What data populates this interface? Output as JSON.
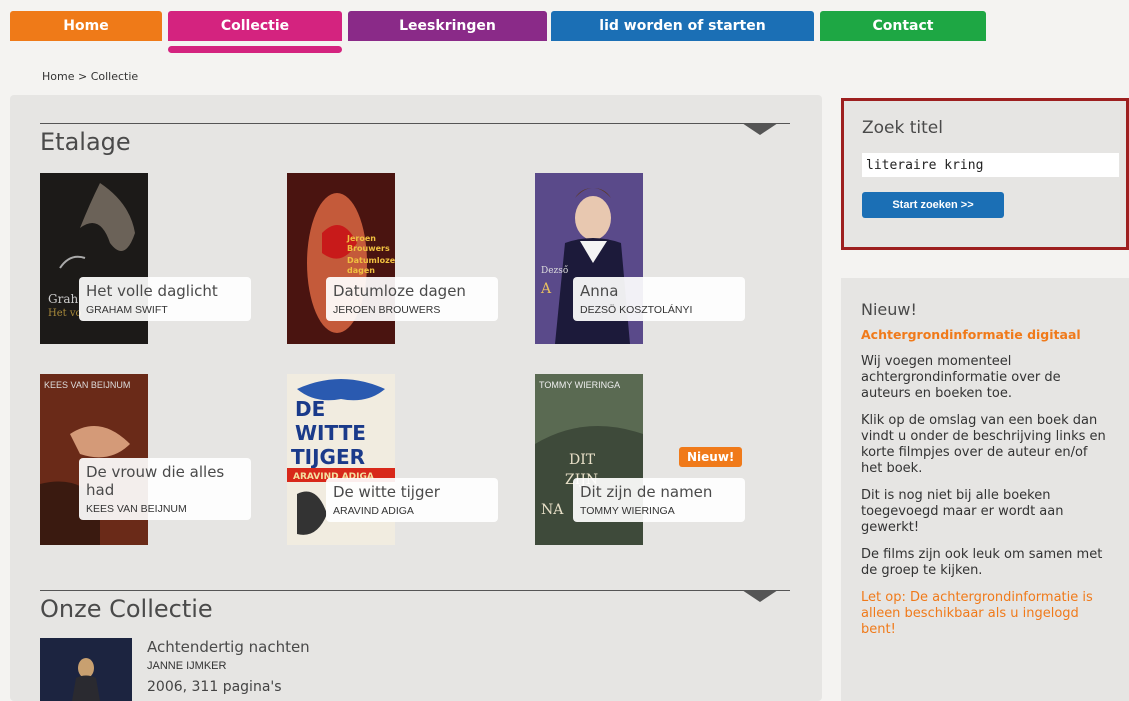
{
  "nav": {
    "tabs": [
      {
        "label": "Home",
        "color": "#ef7a18"
      },
      {
        "label": "Collectie",
        "color": "#d4237f"
      },
      {
        "label": "Leeskringen",
        "color": "#8a2a88"
      },
      {
        "label": "lid worden of starten",
        "color": "#1b6fb5"
      },
      {
        "label": "Contact",
        "color": "#1ea744"
      }
    ]
  },
  "breadcrumb": "Home > Collectie",
  "etalage": {
    "title": "Etalage",
    "books": [
      {
        "title": "Het volle daglicht",
        "author": "GRAHAM SWIFT",
        "cover_text": "Graham Swift\nHet volle",
        "cover_color": "#1c1a18"
      },
      {
        "title": "Datumloze dagen",
        "author": "JEROEN BROUWERS",
        "cover_text": "Jeroen Brouwers Datumloze dagen",
        "cover_color": "#4a1410"
      },
      {
        "title": "Anna",
        "author": "DEZSÖ KOSZTOLÁNYI",
        "cover_text": "Dezső Kosztolányi Anna",
        "cover_color": "#3a2a6a"
      },
      {
        "title": "De vrouw die alles had",
        "author": "KEES VAN BEIJNUM",
        "cover_text": "KEES VAN BEIJNUM",
        "cover_color": "#7a3a1e"
      },
      {
        "title": "De witte tijger",
        "author": "ARAVIND ADIGA",
        "cover_text": "DE WITTE TIJGER ARAVIND ADIGA",
        "cover_color": "#f1ece0"
      },
      {
        "title": "Dit zijn de namen",
        "author": "TOMMY WIERINGA",
        "cover_text": "TOMMY WIERINGA DIT ZIJN DE NAMEN",
        "cover_color": "#4e5a48",
        "badge": "Nieuw!"
      }
    ]
  },
  "collectie": {
    "title": "Onze Collectie",
    "item": {
      "title": "Achtendertig nachten",
      "author": "JANNE IJMKER",
      "meta": "2006, 311 pagina's"
    }
  },
  "search": {
    "title": "Zoek titel",
    "value": "literaire kring",
    "button": "Start zoeken >>"
  },
  "news": {
    "title": "Nieuw!",
    "subtitle": "Achtergrondinformatie digitaal",
    "paragraphs": [
      "Wij voegen momenteel achtergrondinformatie over de auteurs en boeken toe.",
      "Klik op de omslag van een boek dan vindt u onder de beschrijving links en korte filmpjes over de auteur en/of het boek.",
      "Dit is nog niet bij alle boeken toegevoegd maar er wordt aan gewerkt!",
      "De films zijn ook leuk om samen met de groep te kijken."
    ],
    "note": "Let op: De achtergrondinformatie is alleen beschikbaar als u ingelogd bent!"
  }
}
